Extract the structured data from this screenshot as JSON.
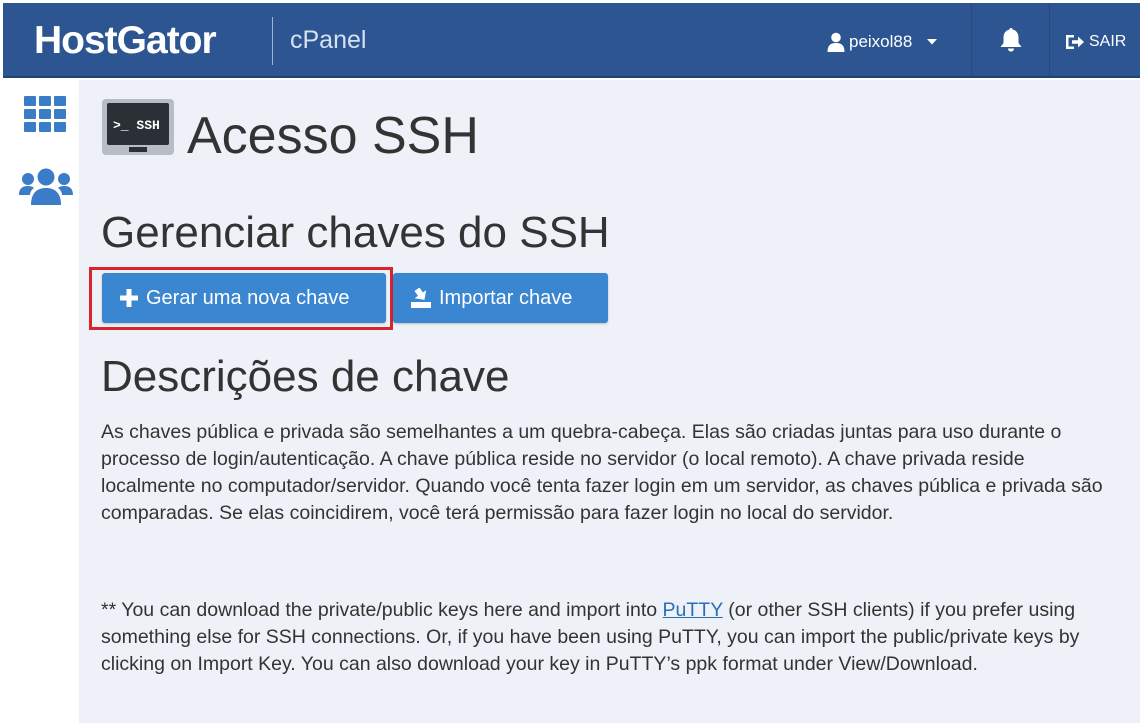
{
  "header": {
    "brand": "HostGator",
    "product": "cPanel",
    "username": "peixol88",
    "logout_label": "SAIR",
    "color": "#2c5592"
  },
  "sidebar": {
    "items": [
      {
        "icon": "grid-icon"
      },
      {
        "icon": "users-icon"
      }
    ]
  },
  "page": {
    "icon_label": ">_ SSH",
    "title": "Acesso SSH"
  },
  "manage": {
    "heading": "Gerenciar chaves do SSH",
    "generate_button": "Gerar uma nova chave",
    "import_button": "Importar chave",
    "button_color": "#3a86d1",
    "highlight_color": "#d8252c"
  },
  "descriptions": {
    "heading": "Descrições de chave",
    "paragraph": "As chaves pública e privada são semelhantes a um quebra-cabeça. Elas são criadas juntas para uso durante o processo de login/autenticação. A chave pública reside no servidor (o local remoto). A chave privada reside localmente no computador/servidor. Quando você tenta fazer login em um servidor, as chaves pública e privada são comparadas. Se elas coincidirem, você terá permissão para fazer login no local do servidor.",
    "note_prefix": "** You can download the private/public keys here and import into ",
    "note_link": "PuTTY",
    "note_suffix": " (or other SSH clients) if you prefer using something else for SSH connections. Or, if you have been using PuTTY, you can import the public/private keys by clicking on Import Key. You can also download your key in PuTTY’s ppk format under View/Download."
  }
}
